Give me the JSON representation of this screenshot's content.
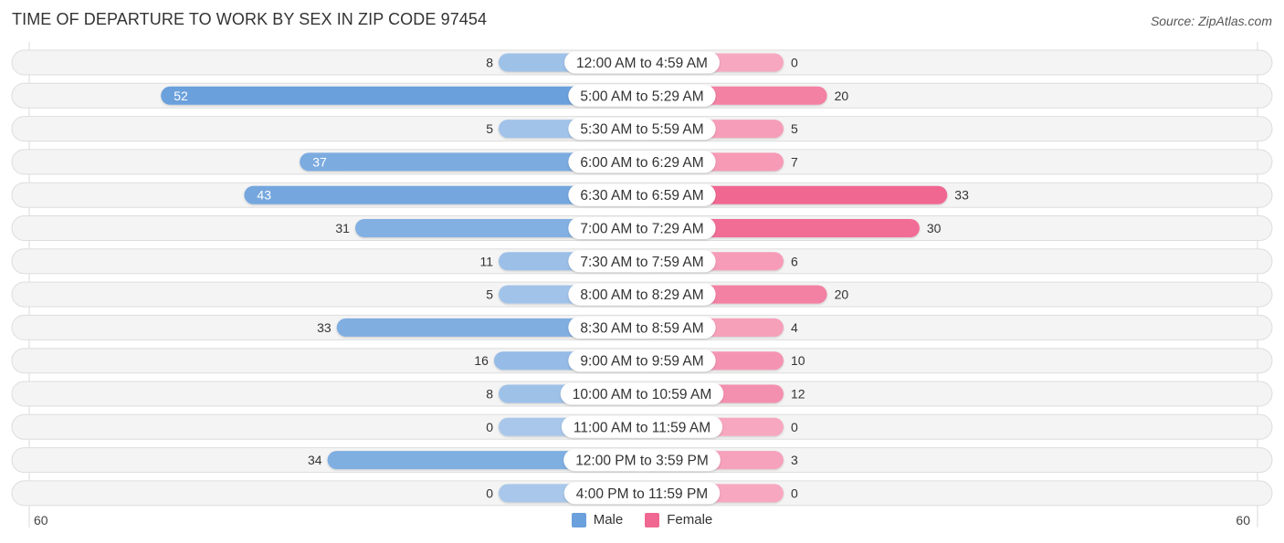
{
  "header": {
    "title": "TIME OF DEPARTURE TO WORK BY SEX IN ZIP CODE 97454",
    "source": "Source: ZipAtlas.com"
  },
  "colors": {
    "male_strong": "#6aa0dc",
    "male_light": "#a8c7ea",
    "female_strong": "#f06792",
    "female_light": "#f7a8c0",
    "row_bg": "#f4f4f4",
    "row_border": "#dddddd"
  },
  "chart_data": {
    "type": "bar",
    "orientation": "horizontal-diverging",
    "title": "TIME OF DEPARTURE TO WORK BY SEX IN ZIP CODE 97454",
    "categories": [
      "12:00 AM to 4:59 AM",
      "5:00 AM to 5:29 AM",
      "5:30 AM to 5:59 AM",
      "6:00 AM to 6:29 AM",
      "6:30 AM to 6:59 AM",
      "7:00 AM to 7:29 AM",
      "7:30 AM to 7:59 AM",
      "8:00 AM to 8:29 AM",
      "8:30 AM to 8:59 AM",
      "9:00 AM to 9:59 AM",
      "10:00 AM to 10:59 AM",
      "11:00 AM to 11:59 AM",
      "12:00 PM to 3:59 PM",
      "4:00 PM to 11:59 PM"
    ],
    "series": [
      {
        "name": "Male",
        "side": "left",
        "values": [
          8,
          52,
          5,
          37,
          43,
          31,
          11,
          5,
          33,
          16,
          8,
          0,
          34,
          0
        ]
      },
      {
        "name": "Female",
        "side": "right",
        "values": [
          0,
          20,
          5,
          7,
          33,
          30,
          6,
          20,
          4,
          10,
          12,
          0,
          3,
          0
        ]
      }
    ],
    "axis": {
      "left_max_label": "60",
      "right_max_label": "60",
      "xlim": [
        -60,
        60
      ]
    },
    "legend": {
      "position": "bottom-center",
      "entries": [
        "Male",
        "Female"
      ]
    },
    "grid": false
  }
}
